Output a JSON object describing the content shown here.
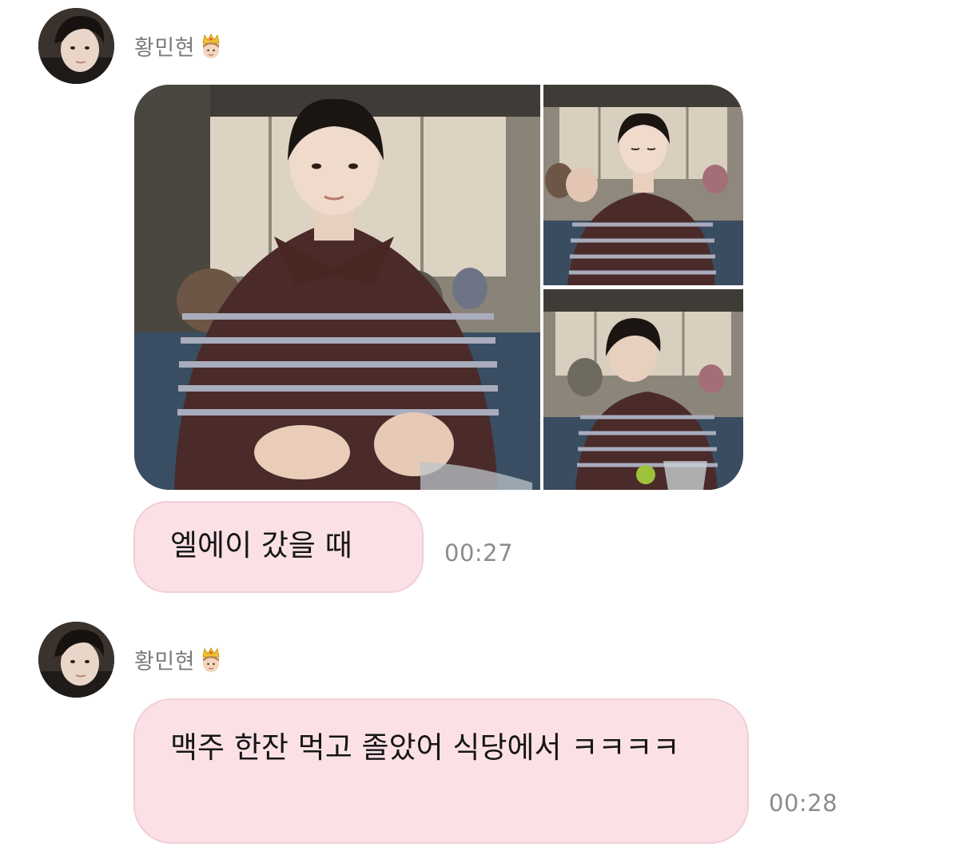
{
  "messages": [
    {
      "sender": "황민현",
      "sender_emoji": "crown-prince-icon",
      "attachment": {
        "type": "photo-album",
        "photo_count": 3
      },
      "text": "엘에이 갔을 때",
      "time": "00:27"
    },
    {
      "sender": "황민현",
      "sender_emoji": "crown-prince-icon",
      "text": "맥주 한잔 먹고 졸았어 식당에서 ㅋㅋㅋㅋ",
      "time": "00:28"
    }
  ],
  "colors": {
    "bubble_background": "#fbe1e6",
    "bubble_border": "#f1cfd6",
    "sender_name": "#7b7b7b",
    "timestamp": "#8c8c8c",
    "page_background": "#ffffff"
  }
}
